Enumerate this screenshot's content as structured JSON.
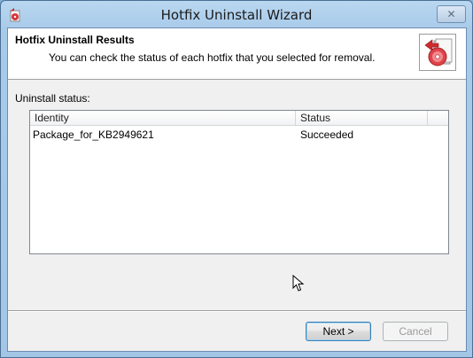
{
  "window": {
    "title": "Hotfix Uninstall Wizard",
    "close_glyph": "✕"
  },
  "header": {
    "title": "Hotfix Uninstall Results",
    "subtitle": "You can check the status of each hotfix that you selected for removal.",
    "icon": "uninstall-disc-icon"
  },
  "status": {
    "label": "Uninstall status:"
  },
  "table": {
    "columns": [
      "Identity",
      "Status"
    ],
    "rows": [
      {
        "identity": "Package_for_KB2949621",
        "status": "Succeeded"
      }
    ]
  },
  "buttons": {
    "next": "Next >",
    "cancel": "Cancel"
  },
  "colors": {
    "title_bar": "#a9cbea",
    "client_bg": "#f0f0f0",
    "accent_red": "#d8343a"
  }
}
